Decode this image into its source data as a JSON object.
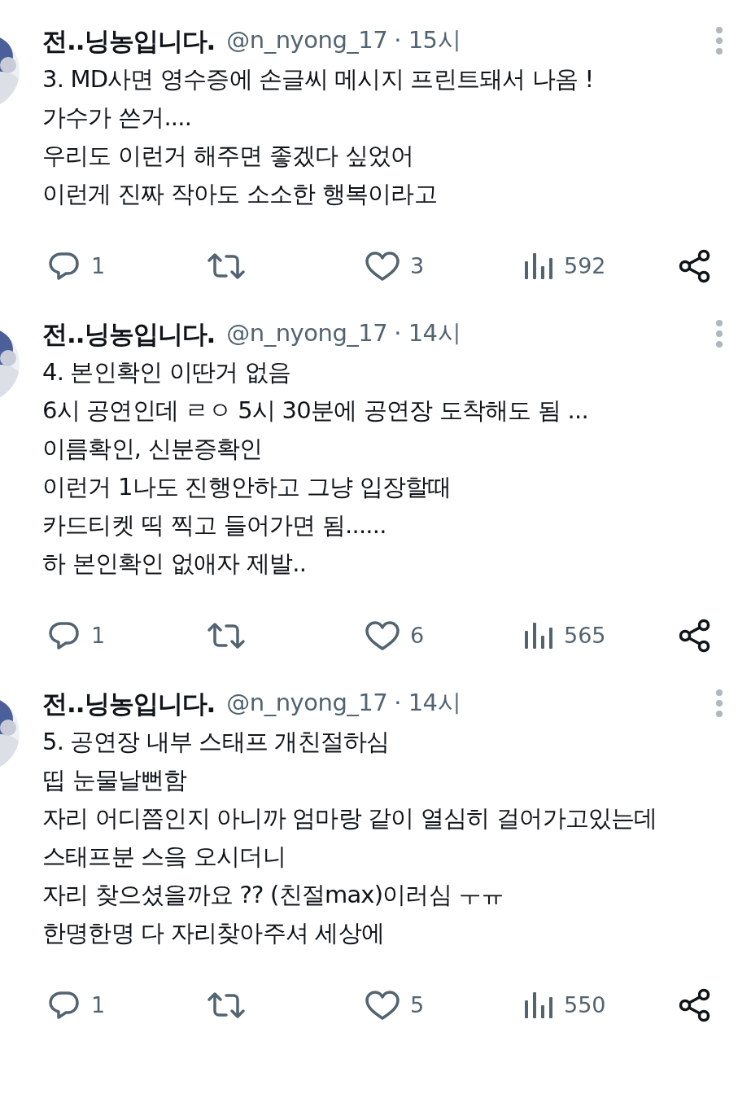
{
  "tweets": [
    {
      "name": "전..닝농입니다.",
      "handle": "@n_nyong_17",
      "time": "· 15시",
      "text": "3. MD사면 영수증에 손글씨 메시지 프린트돼서 나옴 !\n가수가 쓴거....\n우리도 이런거 해주면 좋겠다 싶었어\n이런게 진짜 작아도 소소한 행복이라고",
      "actions": [
        {
          "kind": "reply",
          "count": "1"
        },
        {
          "kind": "retweet"
        },
        {
          "kind": "like",
          "count": "3"
        },
        {
          "kind": "views",
          "count": "592"
        },
        {
          "kind": "share"
        }
      ]
    },
    {
      "name": "전..닝농입니다.",
      "handle": "@n_nyong_17",
      "time": "· 14시",
      "text": "4. 본인확인 이딴거 없음\n6시 공연인데 ㄹㅇ 5시 30분에 공연장 도착해도 됨 ...\n이름확인, 신분증확인\n이런거 1나도 진행안하고 그냥 입장할때\n카드티켓 띡 찍고 들어가면 됨......\n하 본인확인 없애자 제발..",
      "actions": [
        {
          "kind": "reply",
          "count": "1"
        },
        {
          "kind": "retweet"
        },
        {
          "kind": "like",
          "count": "6"
        },
        {
          "kind": "views",
          "count": "565"
        },
        {
          "kind": "share"
        }
      ]
    },
    {
      "name": "전..닝농입니다.",
      "handle": "@n_nyong_17",
      "time": "· 14시",
      "text": "5. 공연장 내부 스태프 개친절하심\n띱 눈물날뻔함\n자리 어디쯤인지 아니까 엄마랑 같이 열심히 걸어가고있는데\n스태프분 스읔 오시더니\n자리 찾으셨을까요 ?? (친절max)이러심 ㅜㅠ\n한명한명 다 자리찾아주셔 세상에",
      "actions": [
        {
          "kind": "reply",
          "count": "1"
        },
        {
          "kind": "retweet"
        },
        {
          "kind": "like",
          "count": "5"
        },
        {
          "kind": "views",
          "count": "550"
        },
        {
          "kind": "share"
        }
      ]
    }
  ]
}
